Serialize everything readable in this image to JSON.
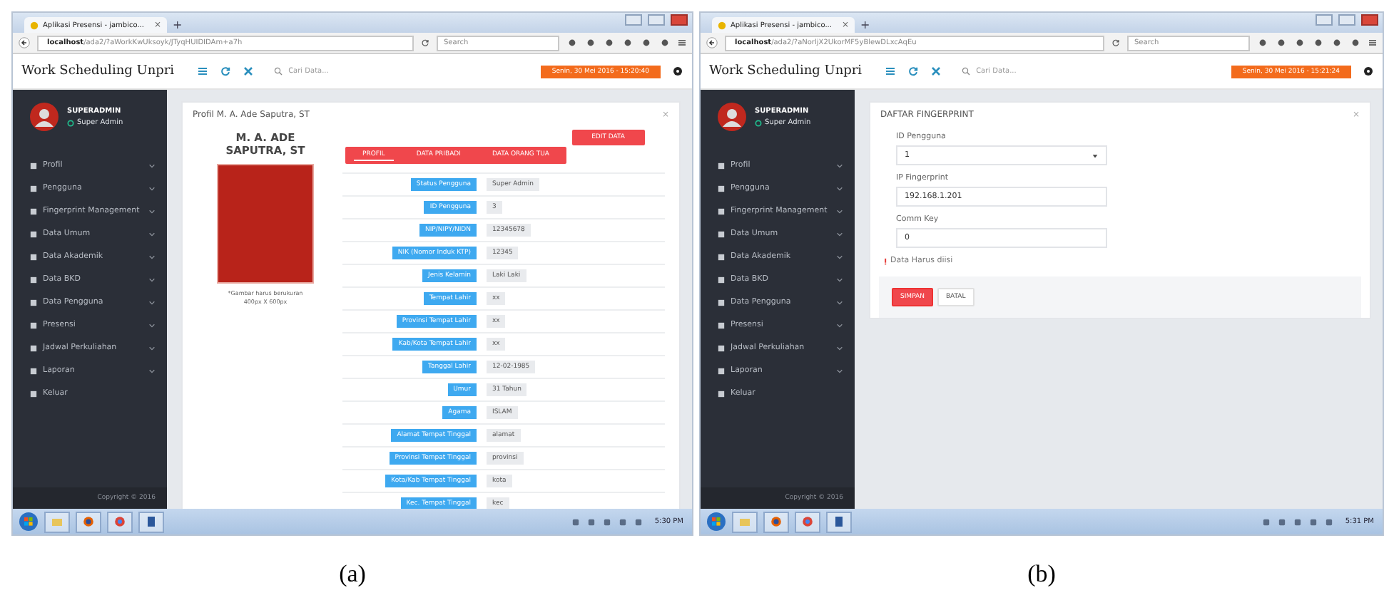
{
  "panels": [
    {
      "caption": "(a)",
      "browser": {
        "tab_title": "Aplikasi Presensi - jambico...",
        "tab_close": "×",
        "new_tab": "+",
        "url_host": "localhost",
        "url_path": "/ada2/?aWorkKwUksoyk/JTyqHUIDIDAm+a7h",
        "search_placeholder": "Search"
      },
      "app": {
        "title": "Work Scheduling Unpri",
        "search_placeholder": "Cari Data...",
        "datetime": "Senin, 30 Mei 2016 - 15:20:40"
      },
      "sidebar": {
        "user_name": "SUPERADMIN",
        "role": "Super Admin",
        "items": [
          {
            "label": "Profil",
            "expandable": true
          },
          {
            "label": "Pengguna",
            "expandable": true
          },
          {
            "label": "Fingerprint Management",
            "expandable": true
          },
          {
            "label": "Data Umum",
            "expandable": true
          },
          {
            "label": "Data Akademik",
            "expandable": true
          },
          {
            "label": "Data BKD",
            "expandable": true
          },
          {
            "label": "Data Pengguna",
            "expandable": true
          },
          {
            "label": "Presensi",
            "expandable": true
          },
          {
            "label": "Jadwal Perkuliahan",
            "expandable": true
          },
          {
            "label": "Laporan",
            "expandable": true
          },
          {
            "label": "Keluar",
            "expandable": false
          }
        ],
        "copyright": "Copyright © 2016"
      },
      "content": {
        "kind": "profile",
        "title": "Profil M. A. Ade Saputra, ST",
        "close": "×",
        "name": "M. A. ADE SAPUTRA, ST",
        "photo_note": "*Gambar harus berukuran 400px X 600px",
        "edit_button": "EDIT DATA",
        "tabs": [
          {
            "label": "PROFIL",
            "selected": true
          },
          {
            "label": "DATA PRIBADI",
            "selected": false
          },
          {
            "label": "DATA ORANG TUA",
            "selected": false
          }
        ],
        "rows": [
          {
            "label": "Status Pengguna",
            "value": "Super Admin"
          },
          {
            "label": "ID Pengguna",
            "value": "3"
          },
          {
            "label": "NIP/NIPY/NIDN",
            "value": "12345678"
          },
          {
            "label": "NIK (Nomor Induk KTP)",
            "value": "12345"
          },
          {
            "label": "Jenis Kelamin",
            "value": "Laki Laki"
          },
          {
            "label": "Tempat Lahir",
            "value": "xx"
          },
          {
            "label": "Provinsi Tempat Lahir",
            "value": "xx"
          },
          {
            "label": "Kab/Kota Tempat Lahir",
            "value": "xx"
          },
          {
            "label": "Tanggal Lahir",
            "value": "12-02-1985"
          },
          {
            "label": "Umur",
            "value": "31  Tahun"
          },
          {
            "label": "Agama",
            "value": "ISLAM"
          },
          {
            "label": "Alamat Tempat Tinggal",
            "value": "alamat"
          },
          {
            "label": "Provinsi Tempat Tinggal",
            "value": "provinsi"
          },
          {
            "label": "Kota/Kab Tempat Tinggal",
            "value": "kota"
          },
          {
            "label": "Kec. Tempat Tinggal",
            "value": "kec"
          }
        ]
      },
      "taskbar": {
        "time": "5:30 PM"
      }
    },
    {
      "caption": "(b)",
      "browser": {
        "tab_title": "Aplikasi Presensi - jambico...",
        "tab_close": "×",
        "new_tab": "+",
        "url_host": "localhost",
        "url_path": "/ada2/?aNorljX2UkorMF5yBlewDLxcAqEu",
        "search_placeholder": "Search"
      },
      "app": {
        "title": "Work Scheduling Unpri",
        "search_placeholder": "Cari Data...",
        "datetime": "Senin, 30 Mei 2016 - 15:21:24"
      },
      "sidebar": {
        "user_name": "SUPERADMIN",
        "role": "Super Admin",
        "items": [
          {
            "label": "Profil",
            "expandable": true
          },
          {
            "label": "Pengguna",
            "expandable": true
          },
          {
            "label": "Fingerprint Management",
            "expandable": true
          },
          {
            "label": "Data Umum",
            "expandable": true
          },
          {
            "label": "Data Akademik",
            "expandable": true
          },
          {
            "label": "Data BKD",
            "expandable": true
          },
          {
            "label": "Data Pengguna",
            "expandable": true
          },
          {
            "label": "Presensi",
            "expandable": true
          },
          {
            "label": "Jadwal Perkuliahan",
            "expandable": true
          },
          {
            "label": "Laporan",
            "expandable": true
          },
          {
            "label": "Keluar",
            "expandable": false
          }
        ],
        "copyright": "Copyright © 2016"
      },
      "content": {
        "kind": "form",
        "title": "DAFTAR FINGERPRINT",
        "close": "×",
        "fields": [
          {
            "kind": "select",
            "label": "ID Pengguna",
            "value": "1"
          },
          {
            "kind": "text",
            "label": "IP Fingerprint",
            "value": "192.168.1.201"
          },
          {
            "kind": "text",
            "label": "Comm Key",
            "value": "0"
          }
        ],
        "required_note": "Data Harus diisi",
        "buttons": [
          {
            "label": "SIMPAN",
            "primary": true
          },
          {
            "label": "BATAL",
            "primary": false
          }
        ]
      },
      "taskbar": {
        "time": "5:31 PM"
      }
    }
  ]
}
